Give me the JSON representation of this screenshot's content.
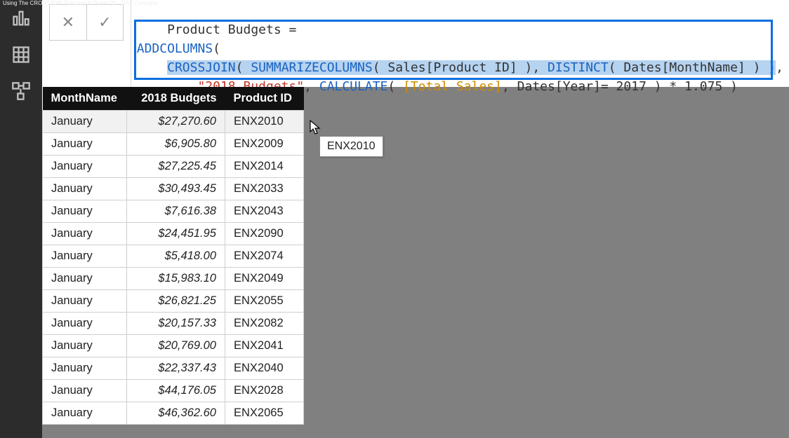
{
  "page_title": "Using The CROSSJOIN Function In Power BI - DAX Concepts",
  "formula": {
    "header": "Product Budgets =",
    "addcolumns": "ADDCOLUMNS",
    "open_paren": "(",
    "crossjoin": "CROSSJOIN",
    "summarize": "SUMMARIZECOLUMNS",
    "sales_col": "Sales[Product ID]",
    "distinct": "DISTINCT",
    "dates_month": "Dates[MonthName]",
    "budget_name": "\"2018 Budgets\"",
    "calculate": "CALCULATE",
    "measure": "[Total Sales]",
    "filter": "Dates[Year]= 2017",
    "mult": " * 1.075 )"
  },
  "table": {
    "headers": {
      "month": "MonthName",
      "budget": "2018 Budgets",
      "product": "Product ID"
    },
    "rows": [
      {
        "month": "January",
        "budget": "$27,270.60",
        "product": "ENX2010"
      },
      {
        "month": "January",
        "budget": "$6,905.80",
        "product": "ENX2009"
      },
      {
        "month": "January",
        "budget": "$27,225.45",
        "product": "ENX2014"
      },
      {
        "month": "January",
        "budget": "$30,493.45",
        "product": "ENX2033"
      },
      {
        "month": "January",
        "budget": "$7,616.38",
        "product": "ENX2043"
      },
      {
        "month": "January",
        "budget": "$24,451.95",
        "product": "ENX2090"
      },
      {
        "month": "January",
        "budget": "$5,418.00",
        "product": "ENX2074"
      },
      {
        "month": "January",
        "budget": "$15,983.10",
        "product": "ENX2049"
      },
      {
        "month": "January",
        "budget": "$26,821.25",
        "product": "ENX2055"
      },
      {
        "month": "January",
        "budget": "$20,157.33",
        "product": "ENX2082"
      },
      {
        "month": "January",
        "budget": "$20,769.00",
        "product": "ENX2041"
      },
      {
        "month": "January",
        "budget": "$22,337.43",
        "product": "ENX2040"
      },
      {
        "month": "January",
        "budget": "$44,176.05",
        "product": "ENX2028"
      },
      {
        "month": "January",
        "budget": "$46,362.60",
        "product": "ENX2065"
      }
    ]
  },
  "tooltip": "ENX2010"
}
